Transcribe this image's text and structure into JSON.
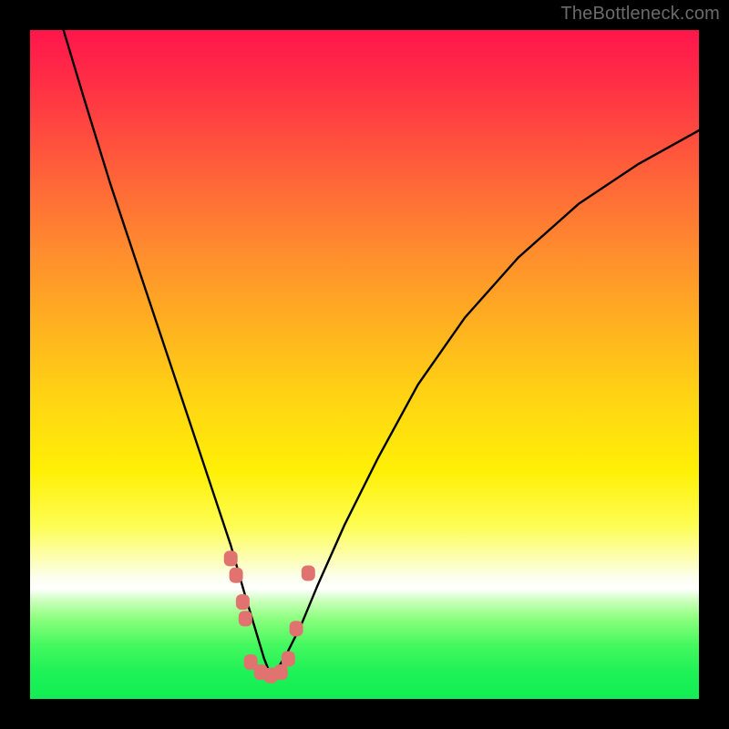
{
  "watermark": "TheBottleneck.com",
  "chart_data": {
    "type": "line",
    "title": "",
    "xlabel": "",
    "ylabel": "",
    "xlim": [
      0,
      100
    ],
    "ylim": [
      0,
      100
    ],
    "note": "Axes without tick labels; values are estimated pixel-fraction percentages read off the plot area. Curve shows a sharp V-shaped minimum near x≈36.",
    "series": [
      {
        "name": "bottleneck-curve",
        "x": [
          5,
          8,
          12,
          16,
          20,
          24,
          28,
          30,
          32,
          33.5,
          35,
          36,
          37,
          38.5,
          40.5,
          43,
          47,
          52,
          58,
          65,
          73,
          82,
          91,
          100
        ],
        "y": [
          100,
          90,
          77,
          65,
          53,
          41,
          29,
          23,
          16,
          11,
          6,
          3.5,
          4.5,
          7,
          11,
          17,
          26,
          36,
          47,
          57,
          66,
          74,
          80,
          85
        ]
      }
    ],
    "markers": {
      "name": "highlight-points",
      "note": "Salmon rounded markers along the trough",
      "points": [
        {
          "x": 30.0,
          "y": 21.0
        },
        {
          "x": 30.8,
          "y": 18.5
        },
        {
          "x": 31.8,
          "y": 14.5
        },
        {
          "x": 32.2,
          "y": 12.0
        },
        {
          "x": 33.0,
          "y": 5.5
        },
        {
          "x": 34.5,
          "y": 4.0
        },
        {
          "x": 36.0,
          "y": 3.5
        },
        {
          "x": 37.5,
          "y": 4.0
        },
        {
          "x": 38.6,
          "y": 6.0
        },
        {
          "x": 39.8,
          "y": 10.5
        },
        {
          "x": 41.6,
          "y": 18.8
        }
      ]
    }
  }
}
